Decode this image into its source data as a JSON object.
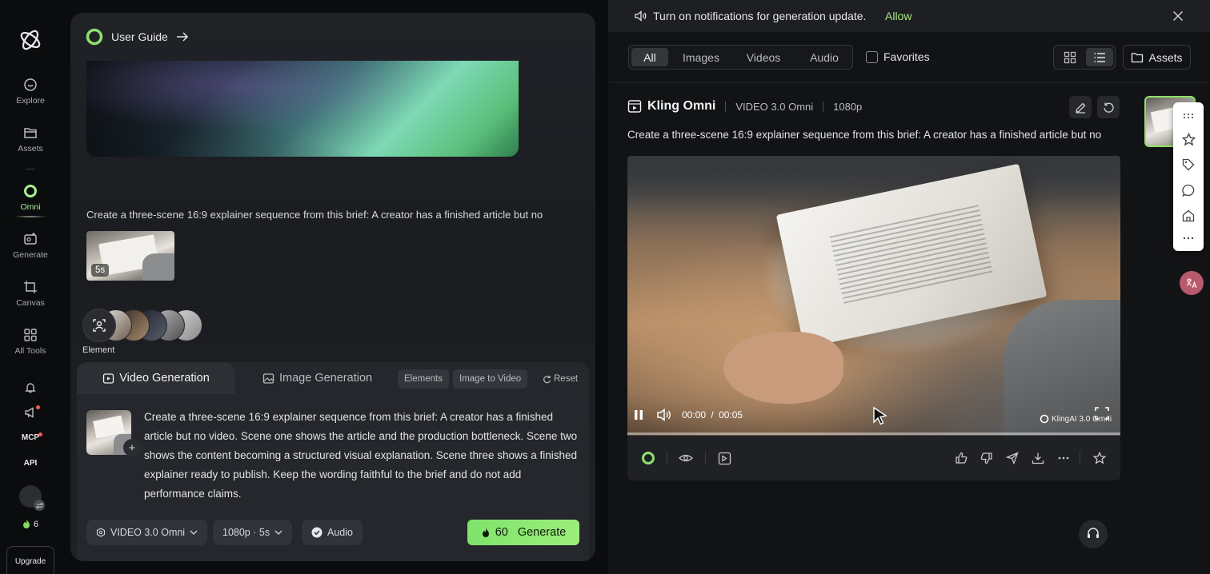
{
  "rail": {
    "items": [
      {
        "label": "Explore",
        "icon": "explore-icon"
      },
      {
        "label": "Assets",
        "icon": "folder-icon"
      },
      {
        "label": "Omni",
        "icon": "omni-icon"
      },
      {
        "label": "Generate",
        "icon": "generate-icon"
      },
      {
        "label": "Canvas",
        "icon": "canvas-icon"
      },
      {
        "label": "All Tools",
        "icon": "grid-icon"
      }
    ],
    "mcp_label": "MCP",
    "api_label": "API",
    "credits": "6",
    "upgrade_label": "Upgrade",
    "active_color": "#a7f08f"
  },
  "mid": {
    "guide_label": "User Guide",
    "prompt_preview": "Create a three-scene 16:9 explainer sequence from this brief: A creator has a finished article but no",
    "thumb_duration": "5s",
    "element_label": "Element",
    "composer": {
      "tab_video": "Video Generation",
      "tab_image": "Image Generation",
      "chip_elements": "Elements",
      "chip_image_to_video": "Image to Video",
      "reset_label": "Reset",
      "prompt": "Create a three-scene 16:9 explainer sequence from this brief: A creator has a finished article but no video. Scene one shows the article and the production bottleneck. Scene two shows the content becoming a structured visual explanation. Scene three shows a finished explainer ready to publish. Keep the wording faithful to the brief and do not add performance claims.",
      "model_option": "VIDEO 3.0 Omni",
      "quality_option": "1080p · 5s",
      "audio_option": "Audio",
      "generate_cost": "60",
      "generate_label": "Generate",
      "accent": "#8ee876"
    }
  },
  "right": {
    "notification": {
      "text": "Turn on notifications for generation update.",
      "action": "Allow"
    },
    "filters": [
      "All",
      "Images",
      "Videos",
      "Audio"
    ],
    "active_filter": "All",
    "favorites_label": "Favorites",
    "assets_label": "Assets",
    "card": {
      "title": "Kling Omni",
      "model": "VIDEO 3.0 Omni",
      "resolution": "1080p",
      "prompt": "Create a three-scene 16:9 explainer sequence from this brief: A creator has a finished article but no",
      "time_current": "00:00",
      "time_sep": "/",
      "time_total": "00:05",
      "progress": 0.0,
      "watermark": "KlingAI 3.0 Omni"
    }
  }
}
